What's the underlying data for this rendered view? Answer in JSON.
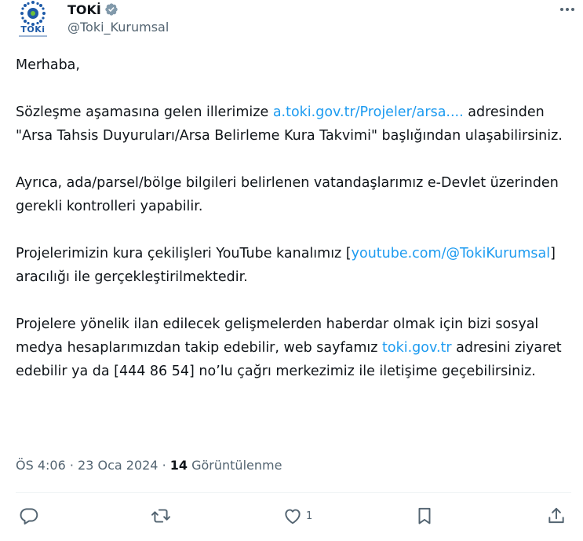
{
  "author": {
    "display_name": "TOKİ",
    "handle": "@Toki_Kurumsal",
    "avatar_logo_text": "TOKi"
  },
  "tweet": {
    "greeting": "Merhaba,",
    "p1_text_a": "Sözleşme aşamasına gelen illerimize ",
    "p1_link": "a.toki.gov.tr/Projeler/arsa....",
    "p1_text_b": " adresinden \"Arsa Tahsis Duyuruları/Arsa Belirleme Kura Takvimi\" başlığından ulaşabilirsiniz.",
    "p2_text": "Ayrıca, ada/parsel/bölge bilgileri belirlenen vatandaşlarımız e-Devlet üzerinden gerekli kontrolleri yapabilir.",
    "p3_text_a": "Projelerimizin kura çekilişleri YouTube kanalımız [",
    "p3_link": "youtube.com/@TokiKurumsal",
    "p3_text_b": "] aracılığı ile gerçekleştirilmektedir.",
    "p4_text_a": "Projelere yönelik ilan edilecek gelişmelerden haberdar olmak için bizi sosyal medya hesaplarımızdan takip edebilir, web sayfamız ",
    "p4_link": "toki.gov.tr",
    "p4_text_b": " adresini ziyaret edebilir ya da [444 86 54] no’lu çağrı merkezimiz ile iletişime geçebilirsiniz."
  },
  "meta": {
    "time": "ÖS 4:06",
    "sep1": " · ",
    "date": "23 Oca 2024",
    "sep2": " · ",
    "views_count": "14",
    "views_label": " Görüntülenme"
  },
  "actions": {
    "reply_icon": "reply-icon",
    "retweet_icon": "retweet-icon",
    "like_icon": "heart-icon",
    "like_count": "1",
    "bookmark_icon": "bookmark-icon",
    "share_icon": "share-icon"
  },
  "colors": {
    "link": "#1d9bf0",
    "text": "#0f1419",
    "muted": "#536471",
    "verified": "#829aab"
  }
}
